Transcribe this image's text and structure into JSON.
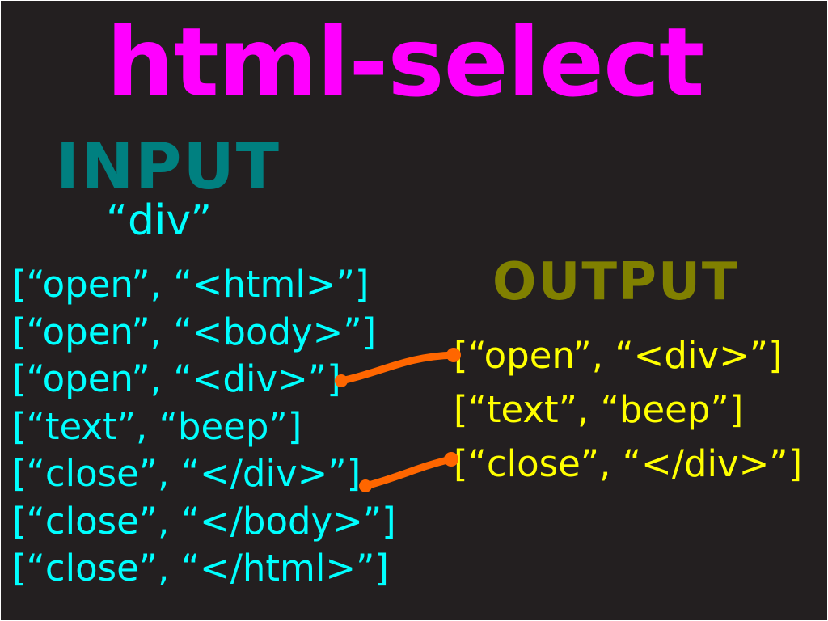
{
  "title": "html-select",
  "input": {
    "heading": "INPUT",
    "selector": "“div”",
    "lines": [
      "[“open”, “<html>”]",
      "[“open”, “<body>”]",
      "[“open”, “<div>”]",
      "[“text”, “beep”]",
      "[“close”, “</div>”]",
      "[“close”, “</body>”]",
      "[“close”, “</html>”]"
    ]
  },
  "output": {
    "heading": "OUTPUT",
    "lines": [
      "[“open”, “<div>”]",
      "[“text”, “beep”]",
      "[“close”, “</div>”]"
    ]
  },
  "colors": {
    "background": "#231f20",
    "title": "#ff00ff",
    "input_heading": "#008080",
    "input_text": "#00ffff",
    "output_heading": "#808000",
    "output_text": "#ffff00",
    "connector": "#ff6600"
  }
}
